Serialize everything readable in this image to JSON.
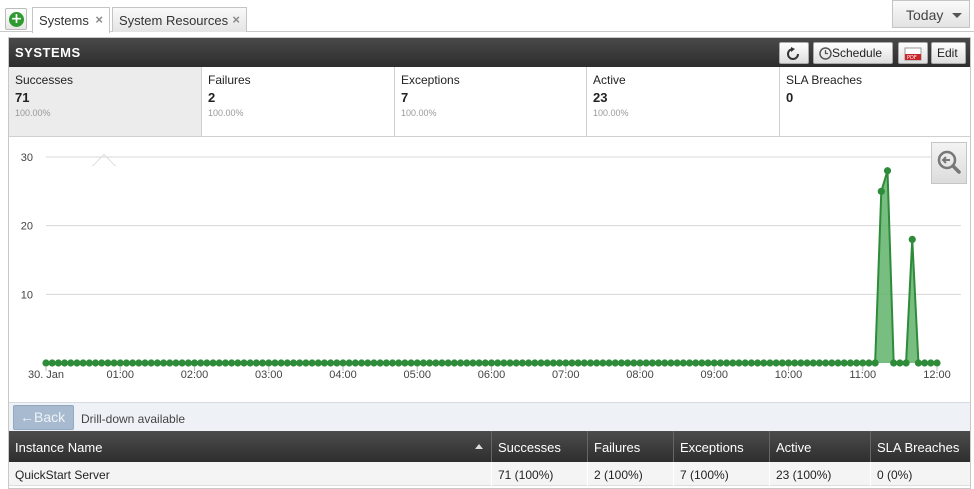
{
  "tabs": [
    {
      "label": "Systems",
      "active": true
    },
    {
      "label": "System Resources",
      "active": false
    }
  ],
  "date_range": {
    "label": "Today"
  },
  "panel": {
    "title": "SYSTEMS",
    "buttons": {
      "schedule": "Schedule",
      "edit": "Edit"
    }
  },
  "metrics": [
    {
      "label": "Successes",
      "value": "71",
      "pct": "100.00%"
    },
    {
      "label": "Failures",
      "value": "2",
      "pct": "100.00%"
    },
    {
      "label": "Exceptions",
      "value": "7",
      "pct": "100.00%"
    },
    {
      "label": "Active",
      "value": "23",
      "pct": "100.00%"
    },
    {
      "label": "SLA Breaches",
      "value": "0",
      "pct": ""
    }
  ],
  "chart_data": {
    "type": "area",
    "series_color": "#2e8b3a",
    "fill_color": "#5fb36a",
    "y_ticks": [
      10,
      20,
      30
    ],
    "ylim": [
      0,
      30
    ],
    "x_ticks": [
      "30. Jan",
      "01:00",
      "02:00",
      "03:00",
      "04:00",
      "05:00",
      "06:00",
      "07:00",
      "08:00",
      "09:00",
      "10:00",
      "11:00",
      "12:00"
    ],
    "x_range_minutes": [
      0,
      720
    ],
    "interval_minutes": 5,
    "spikes": [
      {
        "minute": 675,
        "value": 25
      },
      {
        "minute": 680,
        "value": 28
      },
      {
        "minute": 700,
        "value": 18
      }
    ],
    "grid": true
  },
  "drill": {
    "back_label": "Back",
    "text": "Drill-down available"
  },
  "table": {
    "columns": [
      "Instance Name",
      "Successes",
      "Failures",
      "Exceptions",
      "Active",
      "SLA Breaches"
    ],
    "rows": [
      [
        "QuickStart Server",
        "71 (100%)",
        "2 (100%)",
        "7 (100%)",
        "23 (100%)",
        "0 (0%)"
      ]
    ]
  }
}
